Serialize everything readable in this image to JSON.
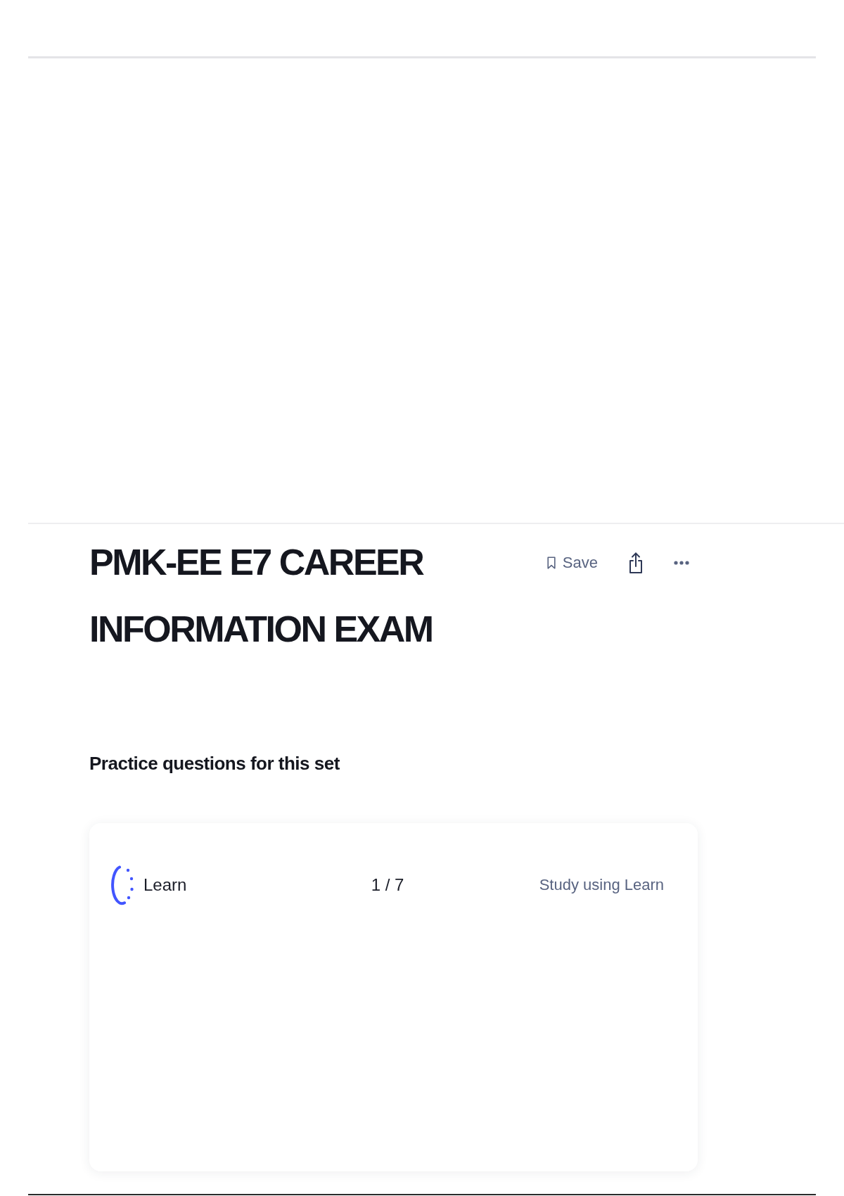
{
  "header": {
    "title": "PMK-EE E7 CAREER INFORMATION EXAM",
    "actions": [
      {
        "kind": "save",
        "label": "Save"
      },
      {
        "kind": "share"
      },
      {
        "kind": "more"
      }
    ]
  },
  "practice": {
    "heading": "Practice questions for this set",
    "mode": {
      "kind": "learn",
      "label": "Learn"
    },
    "progress": "1 / 7",
    "link": "Study using Learn"
  }
}
